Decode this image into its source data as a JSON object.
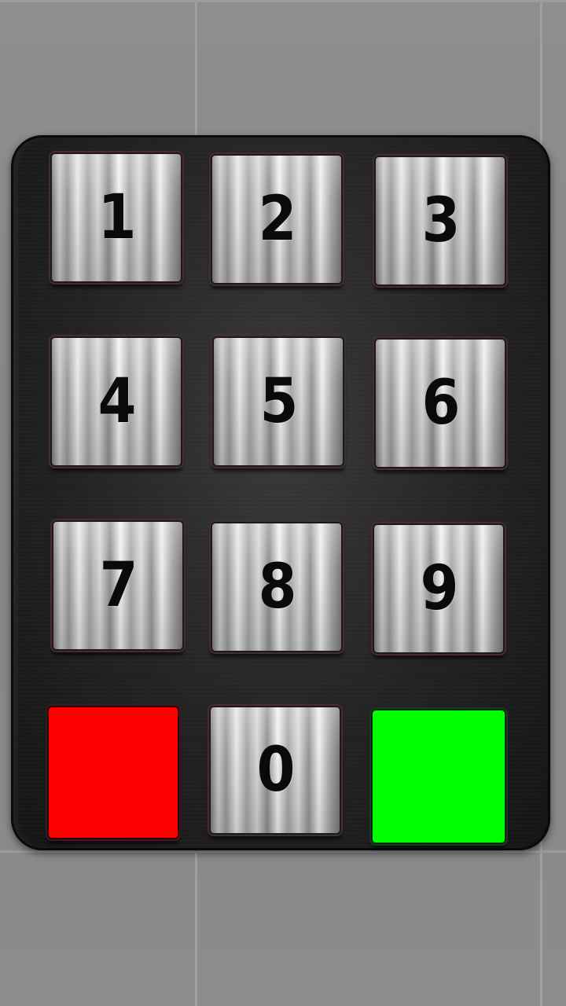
{
  "keypad": {
    "keys": [
      {
        "label": "1"
      },
      {
        "label": "2"
      },
      {
        "label": "3"
      },
      {
        "label": "4"
      },
      {
        "label": "5"
      },
      {
        "label": "6"
      },
      {
        "label": "7"
      },
      {
        "label": "8"
      },
      {
        "label": "9"
      },
      {
        "label": "0"
      }
    ],
    "cancel_color": "#ff0000",
    "confirm_color": "#00ff00",
    "metal_color": "#c9c9c9",
    "housing_color": "#222222"
  }
}
